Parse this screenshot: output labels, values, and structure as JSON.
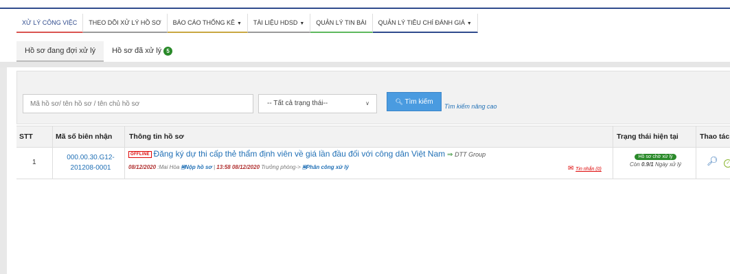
{
  "topnav": {
    "items": [
      {
        "label": "XỬ LÝ CÔNG VIỆC",
        "underline": "#d9534f"
      },
      {
        "label": "THEO DÕI XỬ LÝ HỒ SƠ",
        "underline": "#999999"
      },
      {
        "label": "BÁO CÁO THỐNG KÊ",
        "underline": "#c8a640"
      },
      {
        "label": "TÀI LIỆU HDSD",
        "underline": "#999999"
      },
      {
        "label": "QUẢN LÝ TIN BÀI",
        "underline": "#5cb85c"
      },
      {
        "label": "QUẢN LÝ TIÊU CHÍ ĐÁNH GIÁ",
        "underline": "#2e4a8c"
      }
    ]
  },
  "subtabs": {
    "pending": "Hồ sơ đang đợi xử lý",
    "processed": "Hồ sơ đã xử lý",
    "processed_count": "5"
  },
  "search": {
    "placeholder": "Mã hồ sơ/ tên hồ sơ / tên chủ hồ sơ",
    "status_selected": "-- Tất cả trạng thái--",
    "button_label": "Tìm kiếm",
    "advanced_link": "Tìm kiếm nâng cao"
  },
  "table": {
    "headers": {
      "stt": "STT",
      "receipt_code": "Mã số biên nhận",
      "info": "Thông tin hồ sơ",
      "status": "Trạng thái hiện tại",
      "actions": "Thao tác"
    },
    "rows": [
      {
        "stt": "1",
        "code_line1": "000.00.30.G12-",
        "code_line2": "201208-0001",
        "offline_tag": "OFFLINE",
        "title": "Đăng ký dự thi cấp thẻ thẩm định viên về giá lần đầu đối với công dân Việt Nam",
        "org_arrow": "⇒",
        "org": "DTT Group",
        "date1": "08/12/2020",
        "person": ":Mai Hòa",
        "action1": "Nộp hồ sơ",
        "time2": "13:58 08/12/2020",
        "role": "Trưởng phòng->",
        "action2": "Phân công xử lý",
        "messages": "Tin nhắn (0)",
        "status": "Hồ sơ chờ xử lý",
        "remain_prefix": "Còn",
        "remain_value": "0.9/1",
        "remain_suffix": "Ngày xử lý"
      }
    ]
  }
}
